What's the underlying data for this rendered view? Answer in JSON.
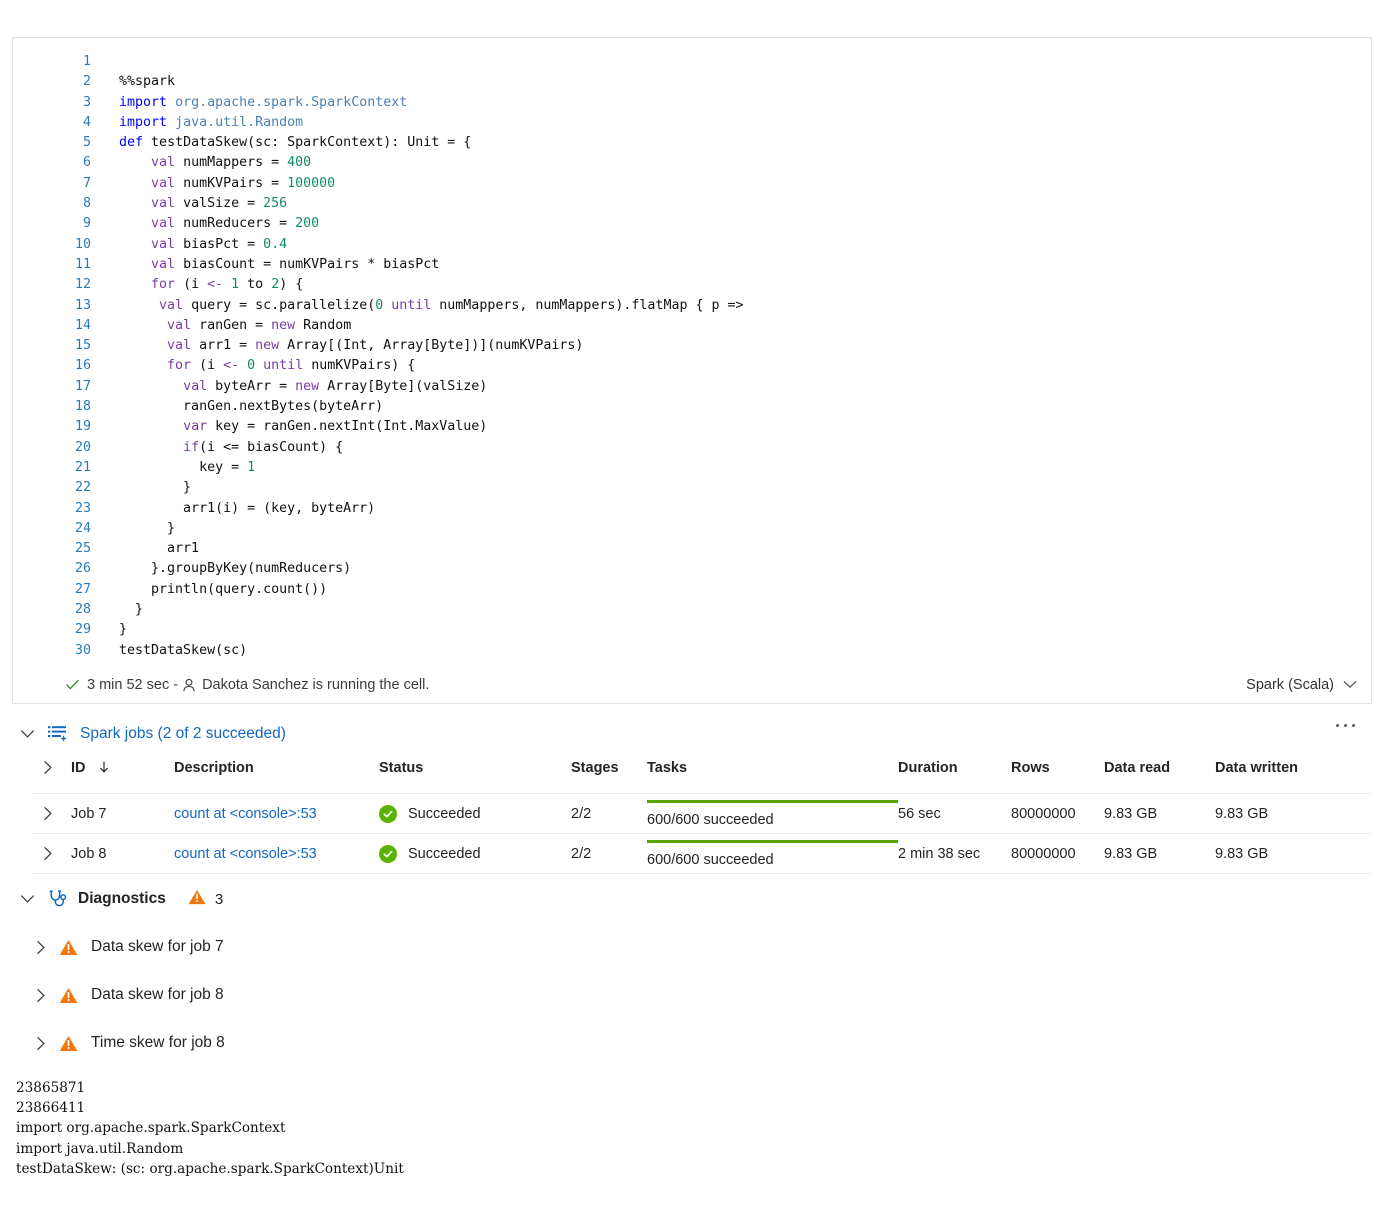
{
  "cell": {
    "language": "Spark (Scala)",
    "status": {
      "duration": "3 min 52 sec - ",
      "user_message": "Dakota Sanchez is running the cell."
    },
    "code_lines": [
      {
        "n": "1",
        "tokens": []
      },
      {
        "n": "2",
        "tokens": [
          {
            "t": "  %%spark",
            "c": "tok-op"
          }
        ]
      },
      {
        "n": "3",
        "tokens": [
          {
            "t": "  ",
            "c": "tok-op"
          },
          {
            "t": "import",
            "c": "tok-kw"
          },
          {
            "t": " ",
            "c": "tok-op"
          },
          {
            "t": "org.apache.spark.SparkContext",
            "c": "tok-pkg"
          }
        ]
      },
      {
        "n": "4",
        "tokens": [
          {
            "t": "  ",
            "c": "tok-op"
          },
          {
            "t": "import",
            "c": "tok-kw"
          },
          {
            "t": " ",
            "c": "tok-op"
          },
          {
            "t": "java.util.Random",
            "c": "tok-pkg"
          }
        ]
      },
      {
        "n": "5",
        "tokens": [
          {
            "t": "  ",
            "c": "tok-op"
          },
          {
            "t": "def",
            "c": "tok-kw"
          },
          {
            "t": " testDataSkew(sc: SparkContext): Unit = {",
            "c": "tok-op"
          }
        ]
      },
      {
        "n": "6",
        "tokens": [
          {
            "t": "      ",
            "c": "tok-op"
          },
          {
            "t": "val",
            "c": "tok-kw2"
          },
          {
            "t": " numMappers = ",
            "c": "tok-op"
          },
          {
            "t": "400",
            "c": "tok-num"
          }
        ]
      },
      {
        "n": "7",
        "tokens": [
          {
            "t": "      ",
            "c": "tok-op"
          },
          {
            "t": "val",
            "c": "tok-kw2"
          },
          {
            "t": " numKVPairs = ",
            "c": "tok-op"
          },
          {
            "t": "100000",
            "c": "tok-num"
          }
        ]
      },
      {
        "n": "8",
        "tokens": [
          {
            "t": "      ",
            "c": "tok-op"
          },
          {
            "t": "val",
            "c": "tok-kw2"
          },
          {
            "t": " valSize = ",
            "c": "tok-op"
          },
          {
            "t": "256",
            "c": "tok-num"
          }
        ]
      },
      {
        "n": "9",
        "tokens": [
          {
            "t": "      ",
            "c": "tok-op"
          },
          {
            "t": "val",
            "c": "tok-kw2"
          },
          {
            "t": " numReducers = ",
            "c": "tok-op"
          },
          {
            "t": "200",
            "c": "tok-num"
          }
        ]
      },
      {
        "n": "10",
        "tokens": [
          {
            "t": "      ",
            "c": "tok-op"
          },
          {
            "t": "val",
            "c": "tok-kw2"
          },
          {
            "t": " biasPct = ",
            "c": "tok-op"
          },
          {
            "t": "0.4",
            "c": "tok-num"
          }
        ]
      },
      {
        "n": "11",
        "tokens": [
          {
            "t": "      ",
            "c": "tok-op"
          },
          {
            "t": "val",
            "c": "tok-kw2"
          },
          {
            "t": " biasCount = numKVPairs * biasPct",
            "c": "tok-op"
          }
        ]
      },
      {
        "n": "12",
        "tokens": [
          {
            "t": "      ",
            "c": "tok-op"
          },
          {
            "t": "for",
            "c": "tok-kw2"
          },
          {
            "t": " (i ",
            "c": "tok-op"
          },
          {
            "t": "<-",
            "c": "tok-kw2"
          },
          {
            "t": " ",
            "c": "tok-op"
          },
          {
            "t": "1",
            "c": "tok-num"
          },
          {
            "t": " to ",
            "c": "tok-op"
          },
          {
            "t": "2",
            "c": "tok-num"
          },
          {
            "t": ") {",
            "c": "tok-op"
          }
        ]
      },
      {
        "n": "13",
        "tokens": [
          {
            "t": "       ",
            "c": "tok-op"
          },
          {
            "t": "val",
            "c": "tok-kw2"
          },
          {
            "t": " query = sc.parallelize(",
            "c": "tok-op"
          },
          {
            "t": "0",
            "c": "tok-num"
          },
          {
            "t": " ",
            "c": "tok-op"
          },
          {
            "t": "until",
            "c": "tok-kw2"
          },
          {
            "t": " numMappers, numMappers).flatMap { p =>",
            "c": "tok-op"
          }
        ]
      },
      {
        "n": "14",
        "tokens": [
          {
            "t": "        ",
            "c": "tok-op"
          },
          {
            "t": "val",
            "c": "tok-kw2"
          },
          {
            "t": " ranGen = ",
            "c": "tok-op"
          },
          {
            "t": "new",
            "c": "tok-kw2"
          },
          {
            "t": " Random",
            "c": "tok-op"
          }
        ]
      },
      {
        "n": "15",
        "tokens": [
          {
            "t": "        ",
            "c": "tok-op"
          },
          {
            "t": "val",
            "c": "tok-kw2"
          },
          {
            "t": " arr1 = ",
            "c": "tok-op"
          },
          {
            "t": "new",
            "c": "tok-kw2"
          },
          {
            "t": " Array[(Int, Array[Byte])](numKVPairs)",
            "c": "tok-op"
          }
        ]
      },
      {
        "n": "16",
        "tokens": [
          {
            "t": "        ",
            "c": "tok-op"
          },
          {
            "t": "for",
            "c": "tok-kw2"
          },
          {
            "t": " (i ",
            "c": "tok-op"
          },
          {
            "t": "<-",
            "c": "tok-kw2"
          },
          {
            "t": " ",
            "c": "tok-op"
          },
          {
            "t": "0",
            "c": "tok-num"
          },
          {
            "t": " ",
            "c": "tok-op"
          },
          {
            "t": "until",
            "c": "tok-kw2"
          },
          {
            "t": " numKVPairs) {",
            "c": "tok-op"
          }
        ]
      },
      {
        "n": "17",
        "tokens": [
          {
            "t": "          ",
            "c": "tok-op"
          },
          {
            "t": "val",
            "c": "tok-kw2"
          },
          {
            "t": " byteArr = ",
            "c": "tok-op"
          },
          {
            "t": "new",
            "c": "tok-kw2"
          },
          {
            "t": " Array[Byte](valSize)",
            "c": "tok-op"
          }
        ]
      },
      {
        "n": "18",
        "tokens": [
          {
            "t": "          ranGen.nextBytes(byteArr)",
            "c": "tok-op"
          }
        ]
      },
      {
        "n": "19",
        "tokens": [
          {
            "t": "          ",
            "c": "tok-op"
          },
          {
            "t": "var",
            "c": "tok-kw2"
          },
          {
            "t": " key = ranGen.nextInt(Int.MaxValue)",
            "c": "tok-op"
          }
        ]
      },
      {
        "n": "20",
        "tokens": [
          {
            "t": "          ",
            "c": "tok-op"
          },
          {
            "t": "if",
            "c": "tok-kw2"
          },
          {
            "t": "(i <= biasCount) {",
            "c": "tok-op"
          }
        ]
      },
      {
        "n": "21",
        "tokens": [
          {
            "t": "            key = ",
            "c": "tok-op"
          },
          {
            "t": "1",
            "c": "tok-num"
          }
        ]
      },
      {
        "n": "22",
        "tokens": [
          {
            "t": "          }",
            "c": "tok-op"
          }
        ]
      },
      {
        "n": "23",
        "tokens": [
          {
            "t": "          arr1(i) = (key, byteArr)",
            "c": "tok-op"
          }
        ]
      },
      {
        "n": "24",
        "tokens": [
          {
            "t": "        }",
            "c": "tok-op"
          }
        ]
      },
      {
        "n": "25",
        "tokens": [
          {
            "t": "        arr1",
            "c": "tok-op"
          }
        ]
      },
      {
        "n": "26",
        "tokens": [
          {
            "t": "      }.groupByKey(numReducers)",
            "c": "tok-op"
          }
        ]
      },
      {
        "n": "27",
        "tokens": [
          {
            "t": "      println(query.count())",
            "c": "tok-op"
          }
        ]
      },
      {
        "n": "28",
        "tokens": [
          {
            "t": "    }",
            "c": "tok-op"
          }
        ]
      },
      {
        "n": "29",
        "tokens": [
          {
            "t": "  }",
            "c": "tok-op"
          }
        ]
      },
      {
        "n": "30",
        "tokens": [
          {
            "t": "  testDataSkew(sc)",
            "c": "tok-op"
          }
        ]
      }
    ]
  },
  "spark_jobs": {
    "title": "Spark jobs (2 of 2 succeeded)",
    "columns": [
      "ID",
      "Description",
      "Status",
      "Stages",
      "Tasks",
      "Duration",
      "Rows",
      "Data read",
      "Data written"
    ],
    "rows": [
      {
        "id": "Job 7",
        "description": "count at <console>:53",
        "status": "Succeeded",
        "stages": "2/2",
        "tasks_label": "600/600 succeeded",
        "tasks_percent": 100,
        "duration": "56 sec",
        "rows": "80000000",
        "data_read": "9.83 GB",
        "data_written": "9.83 GB"
      },
      {
        "id": "Job 8",
        "description": "count at <console>:53",
        "status": "Succeeded",
        "stages": "2/2",
        "tasks_label": "600/600 succeeded",
        "tasks_percent": 100,
        "duration": "2 min 38 sec",
        "rows": "80000000",
        "data_read": "9.83 GB",
        "data_written": "9.83 GB"
      }
    ]
  },
  "diagnostics": {
    "title": "Diagnostics",
    "count": "3",
    "items": [
      {
        "label": "Data skew for job 7"
      },
      {
        "label": "Data skew for job 8"
      },
      {
        "label": "Time skew for job 8"
      }
    ]
  },
  "console_output": "23865871\n23866411\nimport org.apache.spark.SparkContext\nimport java.util.Random\ntestDataSkew: (sc: org.apache.spark.SparkContext)Unit",
  "colors": {
    "link": "#1268c3",
    "success": "#5ab300",
    "warning": "#f2760c",
    "progress": "#5ba300"
  }
}
